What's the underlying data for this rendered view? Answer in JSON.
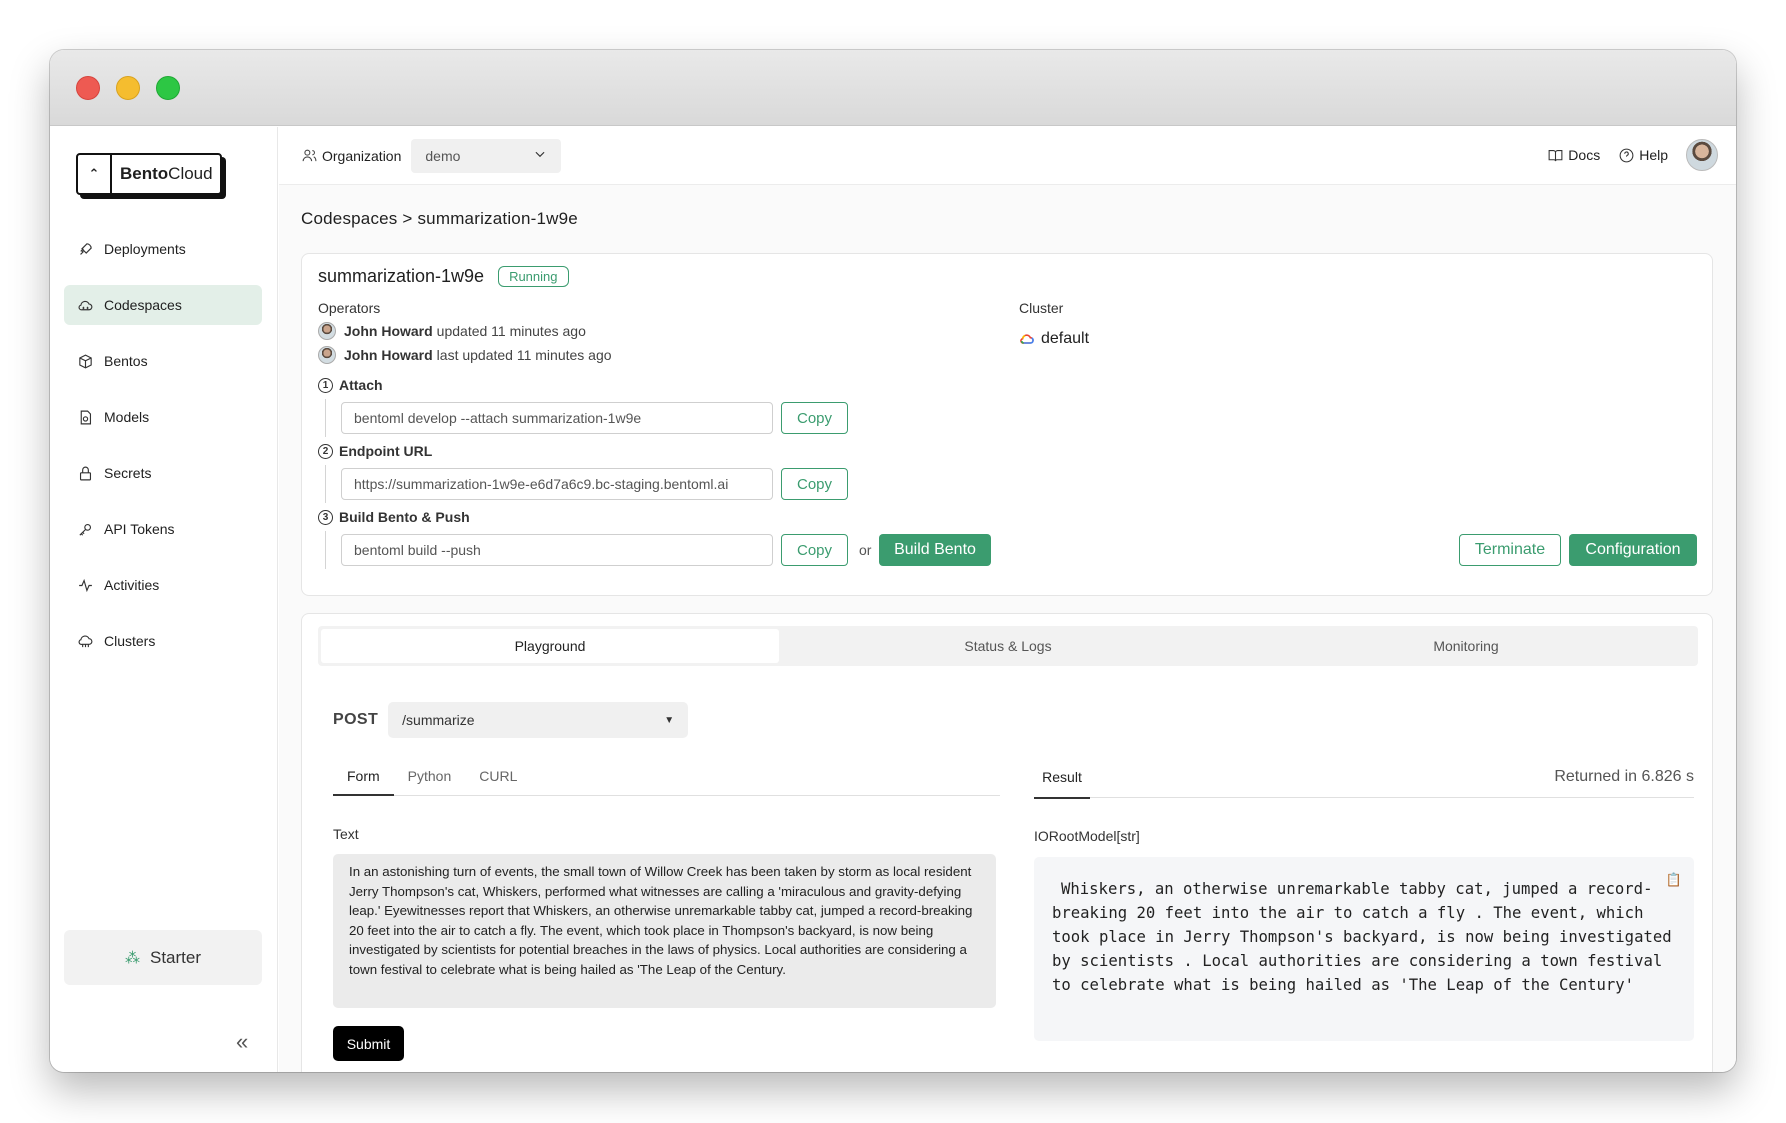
{
  "window": {
    "title": ""
  },
  "sidebar": {
    "logo": {
      "brand_bold": "Bento",
      "brand_rest": "Cloud"
    },
    "items": [
      {
        "label": "Deployments",
        "icon": "rocket-icon",
        "active": false
      },
      {
        "label": "Codespaces",
        "icon": "cloud-icon",
        "active": true
      },
      {
        "label": "Bentos",
        "icon": "box-icon",
        "active": false
      },
      {
        "label": "Models",
        "icon": "model-icon",
        "active": false
      },
      {
        "label": "Secrets",
        "icon": "lock-icon",
        "active": false
      },
      {
        "label": "API Tokens",
        "icon": "key-icon",
        "active": false
      },
      {
        "label": "Activities",
        "icon": "activity-icon",
        "active": false
      },
      {
        "label": "Clusters",
        "icon": "cluster-icon",
        "active": false
      }
    ],
    "plan": "Starter"
  },
  "topbar": {
    "org_label": "Organization",
    "org_value": "demo",
    "docs": "Docs",
    "help": "Help"
  },
  "breadcrumb": "Codespaces > summarization-1w9e",
  "codespace": {
    "name": "summarization-1w9e",
    "status": "Running",
    "operators_label": "Operators",
    "operators": [
      {
        "name": "John Howard",
        "action": "updated 11 minutes ago"
      },
      {
        "name": "John Howard",
        "action": "last updated 11 minutes ago"
      }
    ],
    "cluster_label": "Cluster",
    "cluster_value": "default",
    "steps": [
      {
        "num": "1",
        "label": "Attach",
        "command": "bentoml develop --attach summarization-1w9e",
        "copy": "Copy"
      },
      {
        "num": "2",
        "label": "Endpoint URL",
        "command": "https://summarization-1w9e-e6d7a6c9.bc-staging.bentoml.ai",
        "copy": "Copy"
      },
      {
        "num": "3",
        "label": "Build Bento & Push",
        "command": "bentoml build --push",
        "copy": "Copy"
      }
    ],
    "or_text": "or",
    "build_button": "Build Bento",
    "terminate_button": "Terminate",
    "configuration_button": "Configuration"
  },
  "panel": {
    "tabs": [
      "Playground",
      "Status & Logs",
      "Monitoring"
    ],
    "method": "POST",
    "endpoint": "/summarize",
    "input_tabs": [
      "Form",
      "Python",
      "CURL"
    ],
    "field_label": "Text",
    "field_value": "In an astonishing turn of events, the small town of Willow Creek has been taken by storm as local resident Jerry Thompson's cat, Whiskers, performed what witnesses are calling a 'miraculous and gravity-defying leap.' Eyewitnesses report that Whiskers, an otherwise unremarkable tabby cat, jumped a record-breaking 20 feet into the air to catch a fly. The event, which took place in Thompson's backyard, is now being investigated by scientists for potential breaches in the laws of physics. Local authorities are considering a town festival to celebrate what is being hailed as 'The Leap of the Century.",
    "submit": "Submit",
    "result_tab": "Result",
    "returned": "Returned in 6.826 s",
    "model_label": "IORootModel[str]",
    "result_text": "Whiskers, an otherwise unremarkable tabby cat, jumped a record-breaking 20 feet into the air to catch a fly . The event, which took place in Jerry Thompson's backyard, is now being investigated by scientists . Local authorities are considering a town festival to celebrate what is being hailed as 'The Leap of the Century'"
  },
  "colors": {
    "accent": "#3b9c6f",
    "active_nav": "#e3efe8"
  }
}
